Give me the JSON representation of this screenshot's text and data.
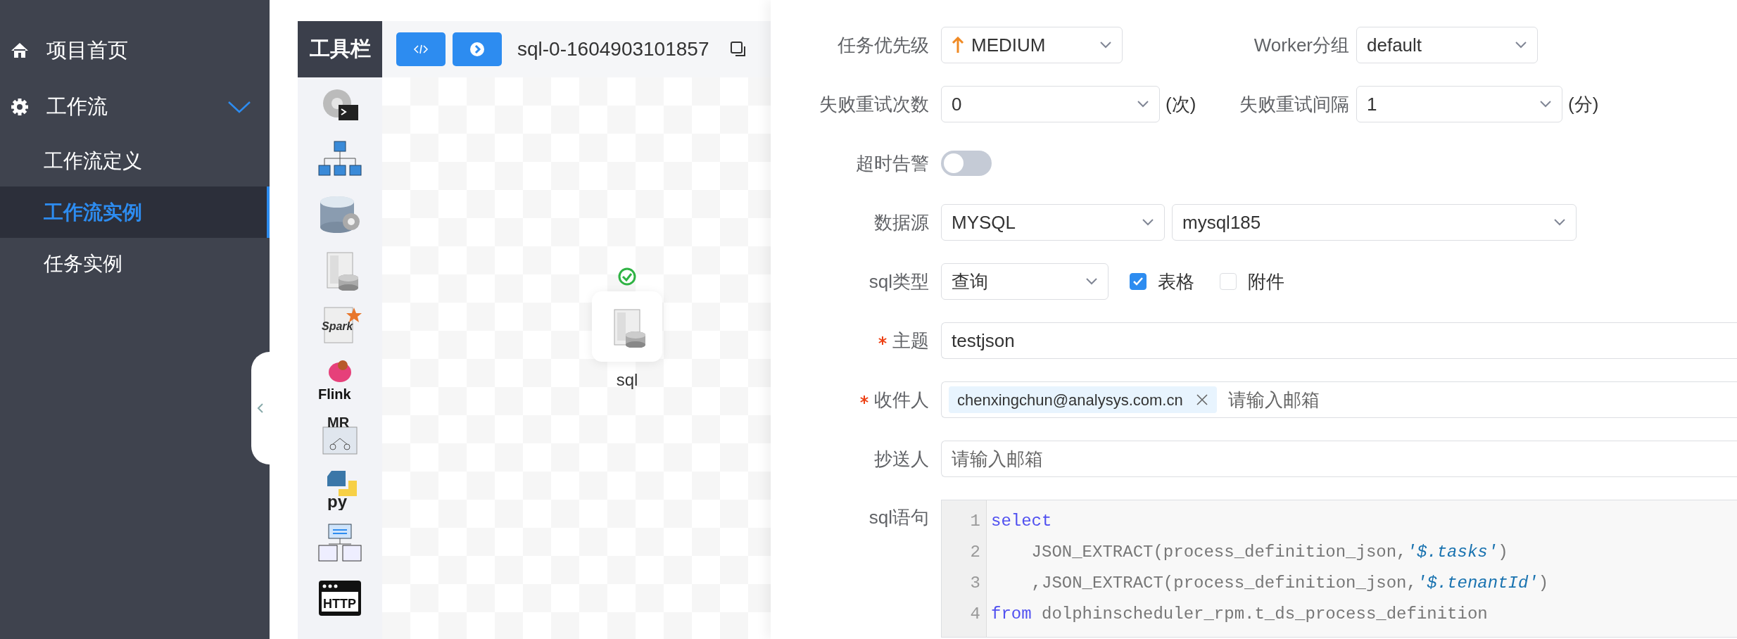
{
  "sidebar": {
    "items": [
      {
        "label": "项目首页",
        "selected": false
      },
      {
        "label": "工作流",
        "selected": false,
        "expanded": true,
        "children": [
          {
            "label": "工作流定义",
            "selected": false
          },
          {
            "label": "工作流实例",
            "selected": true
          },
          {
            "label": "任务实例",
            "selected": false
          }
        ]
      }
    ]
  },
  "toolbar": {
    "title": "工具栏",
    "tools": [
      {
        "kind": "shell"
      },
      {
        "kind": "subprocess"
      },
      {
        "kind": "procedure"
      },
      {
        "kind": "sql"
      },
      {
        "kind": "spark",
        "label": "Spark"
      },
      {
        "kind": "flink",
        "label": "Flink"
      },
      {
        "kind": "mr",
        "label": "MR"
      },
      {
        "kind": "python",
        "label": "py"
      },
      {
        "kind": "dependent"
      },
      {
        "kind": "http",
        "label": "HTTP"
      }
    ]
  },
  "canvas": {
    "title": "sql-0-1604903101857",
    "nodes": [
      {
        "label": "sql",
        "kind": "sql"
      }
    ]
  },
  "form": {
    "priority": {
      "label": "任务优先级",
      "value": "MEDIUM"
    },
    "worker_group": {
      "label": "Worker分组",
      "value": "default"
    },
    "retry_times": {
      "label": "失败重试次数",
      "value": "0",
      "unit": "(次)"
    },
    "retry_interval": {
      "label": "失败重试间隔",
      "value": "1",
      "unit": "(分)"
    },
    "timeout_alarm": {
      "label": "超时告警",
      "on": false
    },
    "datasource": {
      "label": "数据源",
      "type": "MYSQL",
      "value": "mysql185"
    },
    "sql_type": {
      "label": "sql类型",
      "value": "查询",
      "options": [
        {
          "label": "表格",
          "checked": true
        },
        {
          "label": "附件",
          "checked": false
        }
      ]
    },
    "subject": {
      "label": "主题",
      "required": true,
      "value": "testjson"
    },
    "recipients": {
      "label": "收件人",
      "required": true,
      "tags": [
        "chenxingchun@analysys.com.cn"
      ],
      "placeholder": "请输入邮箱"
    },
    "cc": {
      "label": "抄送人",
      "placeholder": "请输入邮箱"
    },
    "sql": {
      "label": "sql语句",
      "lines": [
        {
          "number": "1",
          "tokens": [
            {
              "kind": "keyword",
              "text": "select"
            }
          ]
        },
        {
          "number": "2",
          "tokens": [
            {
              "kind": "plain",
              "text": "    JSON_EXTRACT(process_definition_json,"
            },
            {
              "kind": "string",
              "text": "'$.tasks'"
            },
            {
              "kind": "plain",
              "text": ")"
            }
          ]
        },
        {
          "number": "3",
          "tokens": [
            {
              "kind": "plain",
              "text": "    ,JSON_EXTRACT(process_definition_json,"
            },
            {
              "kind": "string",
              "text": "'$.tenantId'"
            },
            {
              "kind": "plain",
              "text": ")"
            }
          ]
        },
        {
          "number": "4",
          "tokens": [
            {
              "kind": "keyword",
              "text": "from"
            },
            {
              "kind": "plain",
              "text": " dolphinscheduler_rpm.t_ds_process_definition"
            }
          ]
        }
      ]
    }
  }
}
